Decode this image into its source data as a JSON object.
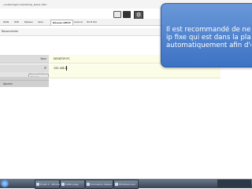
{
  "browser": {
    "url": "...routerlogin.net/setup_basic.htm"
  },
  "toolbar": {
    "icons": [
      "mail-icon",
      "monitor-icon",
      "settings-icon"
    ],
    "settings_glyph": "⚙"
  },
  "tabs": [
    {
      "label": "WAN",
      "active": false
    },
    {
      "label": "WiFi",
      "active": false
    },
    {
      "label": "Réseau",
      "active": false
    },
    {
      "label": "Sécu",
      "active": false
    },
    {
      "label": "Réseau DHCP",
      "active": true
    },
    {
      "label": "Avancé",
      "active": false
    },
    {
      "label": "Wi-Fi Est",
      "active": false
    }
  ],
  "subbar": {
    "label": "Reconnecter"
  },
  "form": {
    "name_label": "Nom",
    "name_value": "DESKTOP-PC",
    "ip_label": "IP",
    "ip_value": "192.168.1.",
    "mac_label": "Connectables",
    "apply_label": "Ajouter",
    "save_label": "Sauver"
  },
  "tooltip": {
    "lines": [
      "Il est recommandé de ne pas",
      "ip fixe qui est dans la plage",
      "automatiquement afin d'éviter"
    ],
    "accent_color": "#3d72c4"
  },
  "taskbar": {
    "items": [
      {
        "label": "Projet 1 - Windows"
      },
      {
        "label": "Cette page"
      },
      {
        "label": "Connexion réseau"
      },
      {
        "label": "Windows Live"
      }
    ]
  }
}
